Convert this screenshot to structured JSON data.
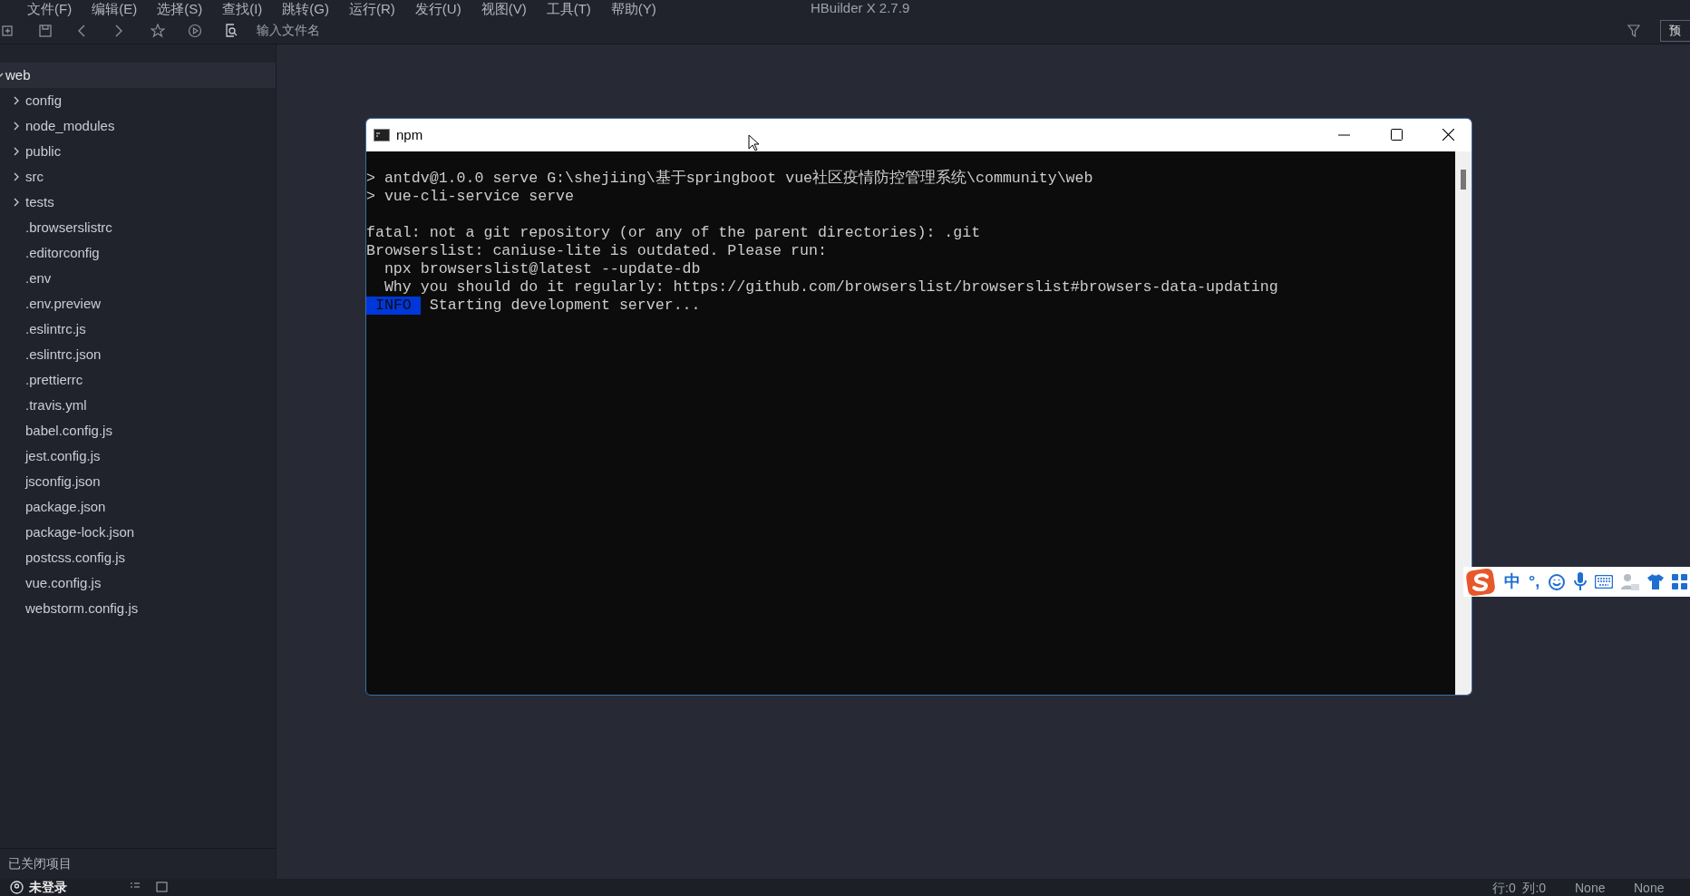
{
  "menu": [
    "文件(F)",
    "编辑(E)",
    "选择(S)",
    "查找(I)",
    "跳转(G)",
    "运行(R)",
    "发行(U)",
    "视图(V)",
    "工具(T)",
    "帮助(Y)"
  ],
  "window": {
    "title": "HBuilder X 2.7.9"
  },
  "toolbar": {
    "search": {
      "placeholder": "输入文件名"
    },
    "preview_button": "预"
  },
  "project_tree": {
    "label": "web",
    "expanded": true,
    "children": [
      {
        "label": "config",
        "kind": "folder",
        "expanded": false
      },
      {
        "label": "node_modules",
        "kind": "folder",
        "expanded": false
      },
      {
        "label": "public",
        "kind": "folder",
        "expanded": false
      },
      {
        "label": "src",
        "kind": "folder",
        "expanded": false
      },
      {
        "label": "tests",
        "kind": "folder",
        "expanded": false
      },
      {
        "label": ".browserslistrc",
        "kind": "file"
      },
      {
        "label": ".editorconfig",
        "kind": "file"
      },
      {
        "label": ".env",
        "kind": "file"
      },
      {
        "label": ".env.preview",
        "kind": "file"
      },
      {
        "label": ".eslintrc.js",
        "kind": "file"
      },
      {
        "label": ".eslintrc.json",
        "kind": "file"
      },
      {
        "label": ".prettierrc",
        "kind": "file"
      },
      {
        "label": ".travis.yml",
        "kind": "file"
      },
      {
        "label": "babel.config.js",
        "kind": "file"
      },
      {
        "label": "jest.config.js",
        "kind": "file"
      },
      {
        "label": "jsconfig.json",
        "kind": "file"
      },
      {
        "label": "package.json",
        "kind": "file"
      },
      {
        "label": "package-lock.json",
        "kind": "file"
      },
      {
        "label": "postcss.config.js",
        "kind": "file"
      },
      {
        "label": "vue.config.js",
        "kind": "file"
      },
      {
        "label": "webstorm.config.js",
        "kind": "file"
      }
    ]
  },
  "closed_projects": "已关闭项目",
  "terminal": {
    "title": "npm",
    "lines": [
      {
        "kind": "prompt",
        "text": "> antdv@1.0.0 serve G:\\shejiing\\基于springboot vue社区疫情防控管理系统\\community\\web"
      },
      {
        "kind": "prompt",
        "text": "> vue-cli-service serve"
      },
      {
        "kind": "blank"
      },
      {
        "kind": "output",
        "text": "fatal: not a git repository (or any of the parent directories): .git"
      },
      {
        "kind": "output",
        "text": "Browserslist: caniuse-lite is outdated. Please run:"
      },
      {
        "kind": "output",
        "text": "  npx browserslist@latest --update-db"
      },
      {
        "kind": "output",
        "text": "  Why you should do it regularly: https://github.com/browserslist/browserslist#browsers-data-updating"
      },
      {
        "kind": "info",
        "badge": "INFO",
        "text": " Starting development server..."
      }
    ]
  },
  "ime_toolbar": {
    "mode": "中",
    "punctuation": "°,"
  },
  "status_bar": {
    "login": "未登录",
    "position": "行:0  列:0",
    "encoding": "None",
    "syntax": "None"
  }
}
